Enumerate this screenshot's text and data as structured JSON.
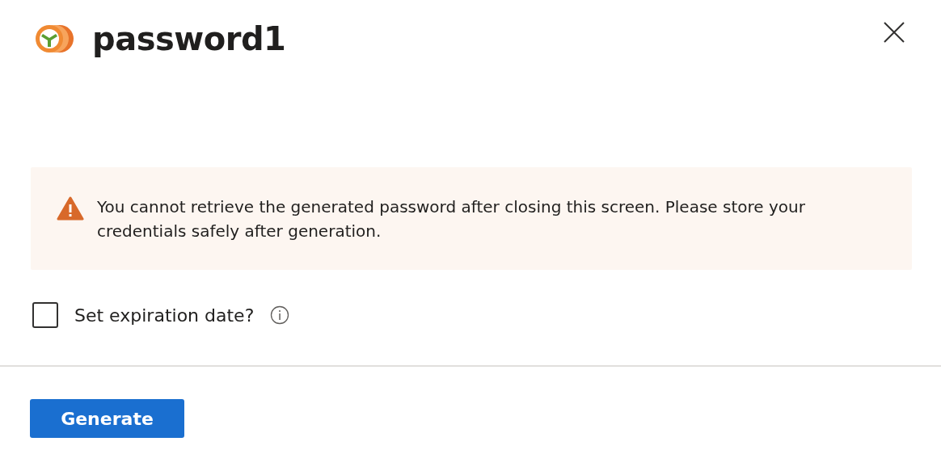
{
  "title": "password1",
  "warning": {
    "text": "You cannot retrieve the generated password after closing this screen. Please store your credentials safely after generation."
  },
  "expiration": {
    "label": "Set expiration date?",
    "checked": false
  },
  "buttons": [
    {
      "label": "Generate",
      "kind": "primary"
    }
  ]
}
